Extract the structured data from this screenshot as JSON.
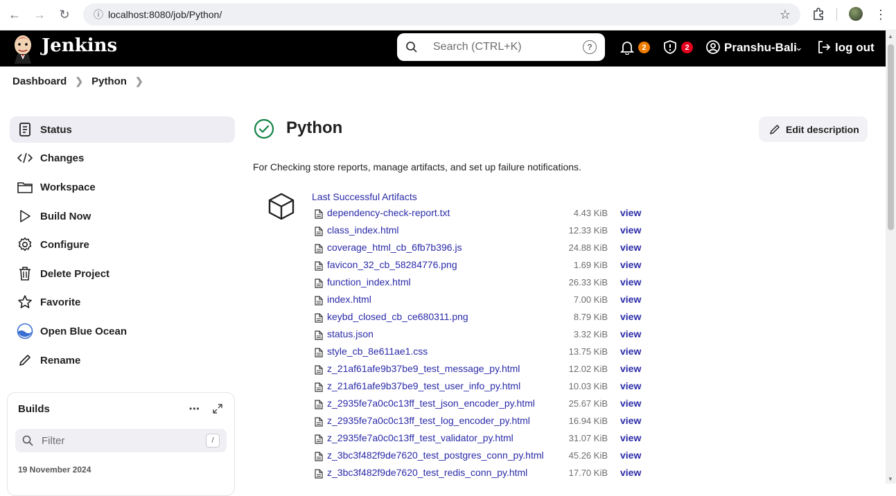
{
  "browser": {
    "url": "localhost:8080/job/Python/"
  },
  "header": {
    "brand": "Jenkins",
    "search_placeholder": "Search (CTRL+K)",
    "notifications_count": "2",
    "security_count": "2",
    "user_name": "Pranshu-Bali",
    "logout_label": "log out",
    "colors": {
      "notification_badge": "#f07d00",
      "security_badge": "#e5001e",
      "header_bg": "#000000"
    }
  },
  "breadcrumb": [
    "Dashboard",
    "Python"
  ],
  "sidebar": {
    "items": [
      {
        "label": "Status",
        "icon": "status-icon"
      },
      {
        "label": "Changes",
        "icon": "code-icon"
      },
      {
        "label": "Workspace",
        "icon": "folder-icon"
      },
      {
        "label": "Build Now",
        "icon": "play-icon"
      },
      {
        "label": "Configure",
        "icon": "gear-icon"
      },
      {
        "label": "Delete Project",
        "icon": "trash-icon"
      },
      {
        "label": "Favorite",
        "icon": "star-icon"
      },
      {
        "label": "Open Blue Ocean",
        "icon": "blue-ocean-icon"
      },
      {
        "label": "Rename",
        "icon": "pencil-icon"
      }
    ]
  },
  "builds": {
    "title": "Builds",
    "filter_placeholder": "Filter",
    "filter_shortcut": "/",
    "date": "19 November 2024"
  },
  "job": {
    "title": "Python",
    "edit_label": "Edit description",
    "description": "For Checking store reports, manage artifacts, and set up failure notifications."
  },
  "artifacts": {
    "heading": "Last Successful Artifacts",
    "view_label": "view",
    "files": [
      {
        "name": "dependency-check-report.txt",
        "size": "4.43 KiB"
      },
      {
        "name": "class_index.html",
        "size": "12.33 KiB"
      },
      {
        "name": "coverage_html_cb_6fb7b396.js",
        "size": "24.88 KiB"
      },
      {
        "name": "favicon_32_cb_58284776.png",
        "size": "1.69 KiB"
      },
      {
        "name": "function_index.html",
        "size": "26.33 KiB"
      },
      {
        "name": "index.html",
        "size": "7.00 KiB"
      },
      {
        "name": "keybd_closed_cb_ce680311.png",
        "size": "8.79 KiB"
      },
      {
        "name": "status.json",
        "size": "3.32 KiB"
      },
      {
        "name": "style_cb_8e611ae1.css",
        "size": "13.75 KiB"
      },
      {
        "name": "z_21af61afe9b37be9_test_message_py.html",
        "size": "12.02 KiB"
      },
      {
        "name": "z_21af61afe9b37be9_test_user_info_py.html",
        "size": "10.03 KiB"
      },
      {
        "name": "z_2935fe7a0c0c13ff_test_json_encoder_py.html",
        "size": "25.67 KiB"
      },
      {
        "name": "z_2935fe7a0c0c13ff_test_log_encoder_py.html",
        "size": "16.94 KiB"
      },
      {
        "name": "z_2935fe7a0c0c13ff_test_validator_py.html",
        "size": "31.07 KiB"
      },
      {
        "name": "z_3bc3f482f9de7620_test_postgres_conn_py.html",
        "size": "45.26 KiB"
      },
      {
        "name": "z_3bc3f482f9de7620_test_redis_conn_py.html",
        "size": "17.70 KiB"
      }
    ]
  }
}
